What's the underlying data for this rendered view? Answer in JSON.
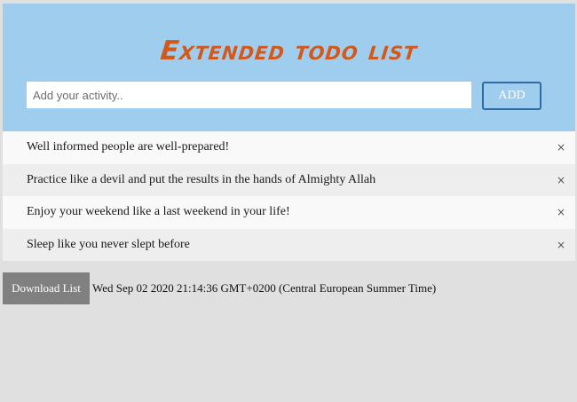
{
  "header": {
    "title": "Extended todo list",
    "input_placeholder": "Add your activity..",
    "input_value": "",
    "add_label": "ADD"
  },
  "todos": [
    {
      "text": "Well informed people are well-prepared!",
      "close_icon": "×"
    },
    {
      "text": "Practice like a devil and put the results in the hands of Almighty Allah",
      "close_icon": "×"
    },
    {
      "text": "Enjoy your weekend like a last weekend in your life!",
      "close_icon": "×"
    },
    {
      "text": "Sleep like you never slept before",
      "close_icon": "×"
    }
  ],
  "footer": {
    "download_label": "Download List",
    "timestamp": "Wed Sep 02 2020 21:14:36 GMT+0200 (Central European Summer Time)"
  },
  "colors": {
    "header_bg": "#9ecdee",
    "title": "#d3581a",
    "add_border": "#2e6da4",
    "download_bg": "#808080",
    "page_bg": "#e0e0e0"
  }
}
